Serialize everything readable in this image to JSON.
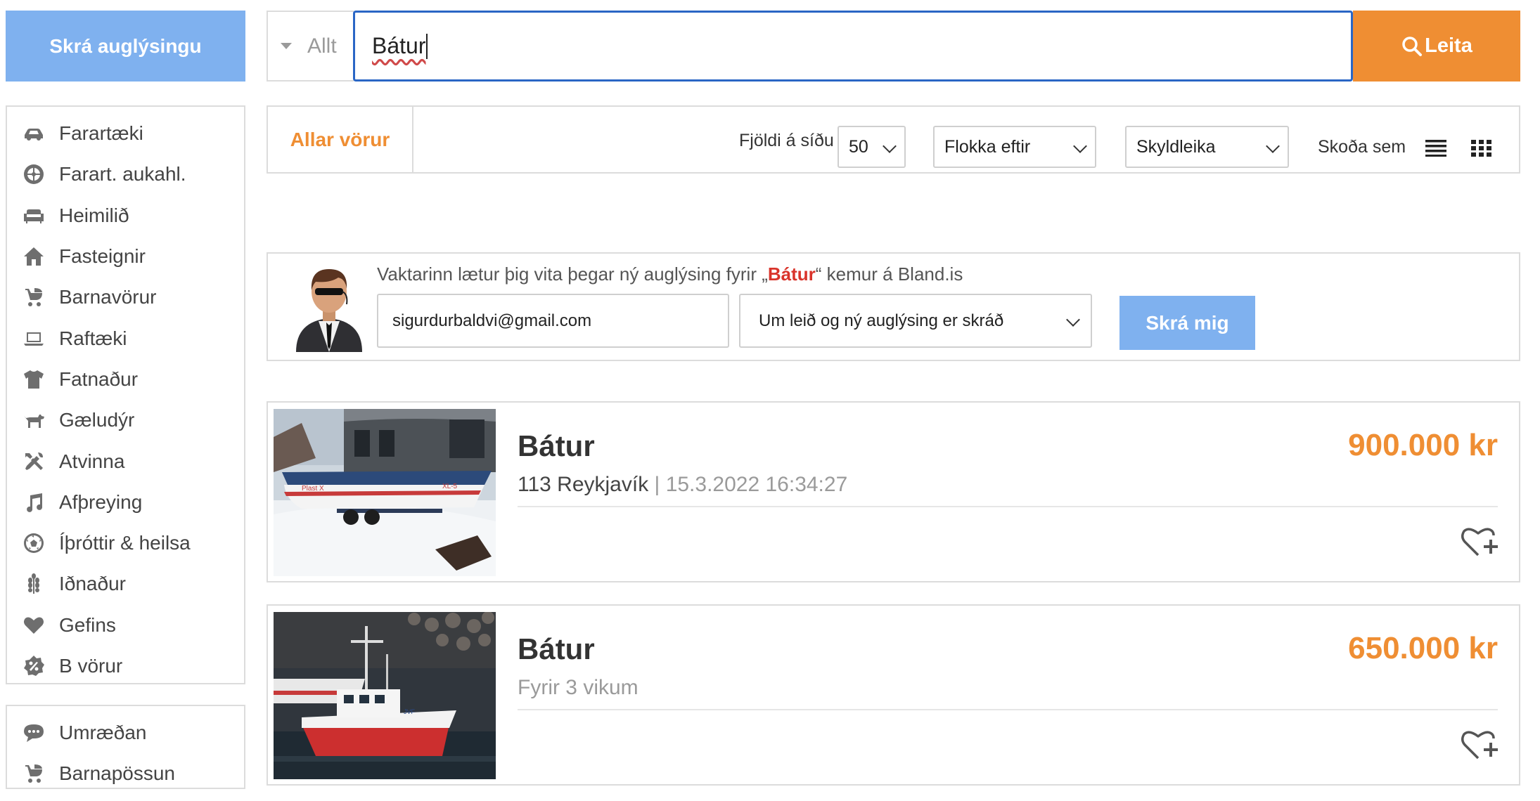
{
  "header": {
    "post_ad_label": "Skrá auglýsingu",
    "search_scope": "Allt",
    "search_query": "Bátur",
    "search_button_label": "Leita"
  },
  "sidebar": {
    "categories": [
      {
        "label": "Farartæki",
        "icon": "car-icon"
      },
      {
        "label": "Farart. aukahl.",
        "icon": "wheel-icon"
      },
      {
        "label": "Heimilið",
        "icon": "sofa-icon"
      },
      {
        "label": "Fasteignir",
        "icon": "home-icon"
      },
      {
        "label": "Barnavörur",
        "icon": "stroller-icon"
      },
      {
        "label": "Raftæki",
        "icon": "laptop-icon"
      },
      {
        "label": "Fatnaður",
        "icon": "shirt-icon"
      },
      {
        "label": "Gæludýr",
        "icon": "dog-icon"
      },
      {
        "label": "Atvinna",
        "icon": "tools-icon"
      },
      {
        "label": "Afþreying",
        "icon": "music-note-icon"
      },
      {
        "label": "Íþróttir & heilsa",
        "icon": "soccer-ball-icon"
      },
      {
        "label": "Iðnaður",
        "icon": "wheat-icon"
      },
      {
        "label": "Gefins",
        "icon": "heart-icon"
      },
      {
        "label": "B vörur",
        "icon": "percent-badge-icon"
      }
    ],
    "extra": [
      {
        "label": "Umræðan",
        "icon": "chat-bubble-icon"
      },
      {
        "label": "Barnapössun",
        "icon": "stroller-icon"
      }
    ]
  },
  "toolbar": {
    "all_products_label": "Allar vörur",
    "per_page_label": "Fjöldi á síðu",
    "per_page_value": "50",
    "category_sort_value": "Flokka eftir",
    "relevance_value": "Skyldleika",
    "view_as_label": "Skoða sem"
  },
  "watcher": {
    "text_before": "Vaktarinn lætur þig vita þegar ný auglýsing fyrir „",
    "keyword": "Bátur",
    "text_after": "“ kemur á Bland.is",
    "email_value": "sigurdurbaldvi@gmail.com",
    "frequency_value": "Um leið og ný auglýsing er skráð",
    "subscribe_label": "Skrá mig"
  },
  "listings": [
    {
      "title": "Bátur",
      "location": "113 Reykjavík",
      "separator": "|",
      "date": "15.3.2022 16:34:27",
      "price": "900.000 kr"
    },
    {
      "title": "Bátur",
      "posted": "Fyrir 3 vikum",
      "price": "650.000 kr"
    }
  ],
  "colors": {
    "accent_orange": "#ef8e33",
    "button_blue": "#7fb1ef",
    "focus_blue": "#2a66c5",
    "keyword_red": "#d9342b"
  }
}
